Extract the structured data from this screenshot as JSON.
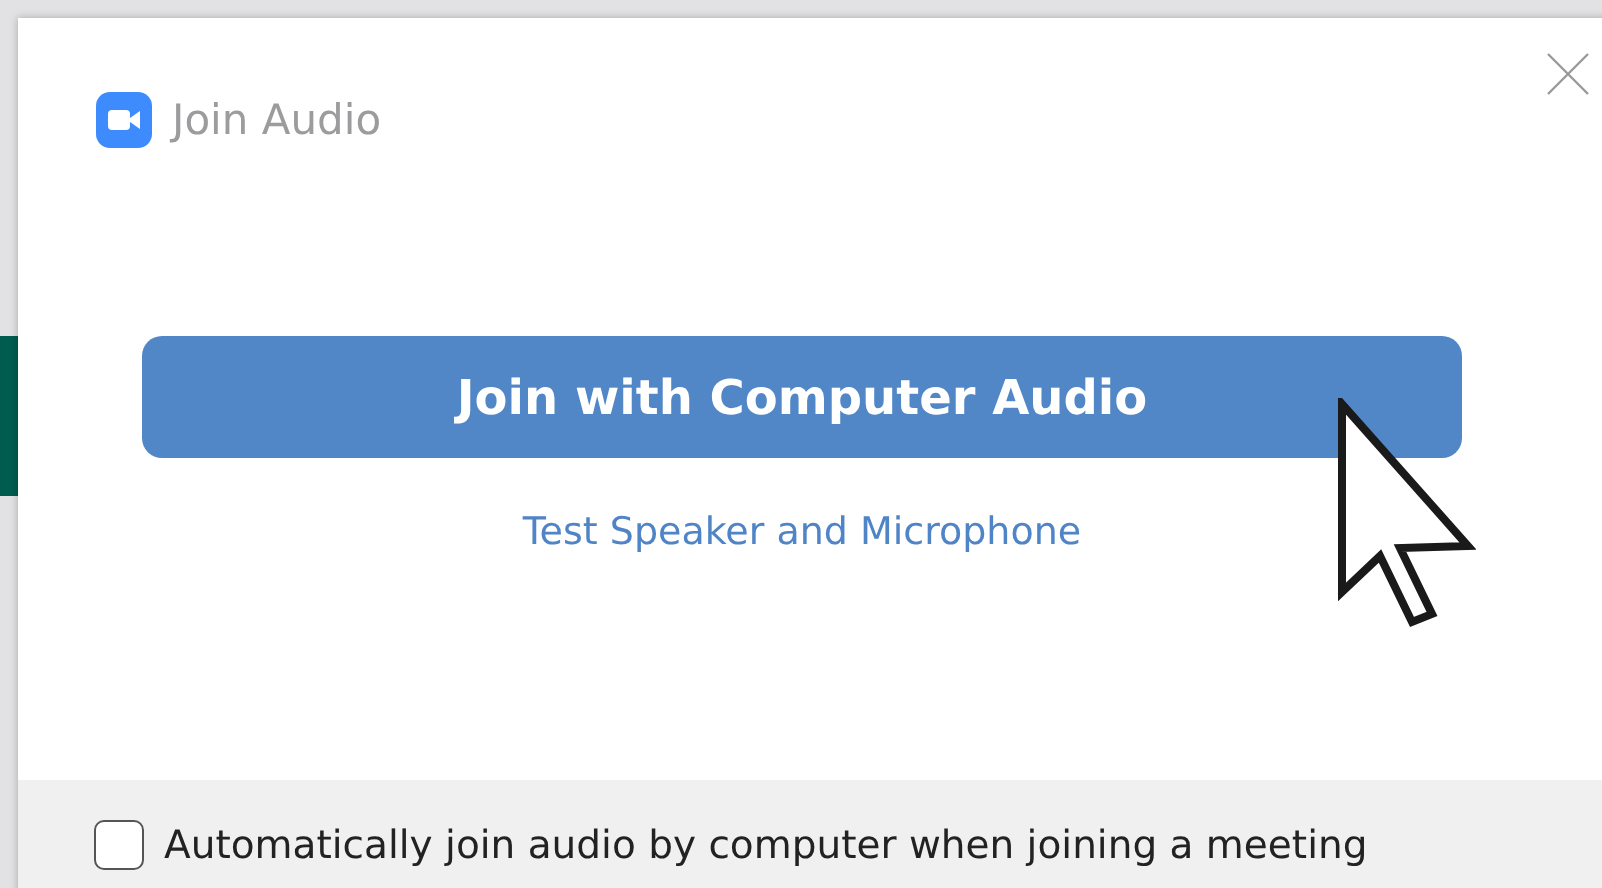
{
  "dialog": {
    "title": "Join Audio"
  },
  "primary_button": {
    "label": "Join with Computer Audio"
  },
  "test_link": {
    "label": "Test Speaker and Microphone"
  },
  "auto_join": {
    "label": "Automatically join audio by computer when joining a meeting",
    "checked": false
  }
}
